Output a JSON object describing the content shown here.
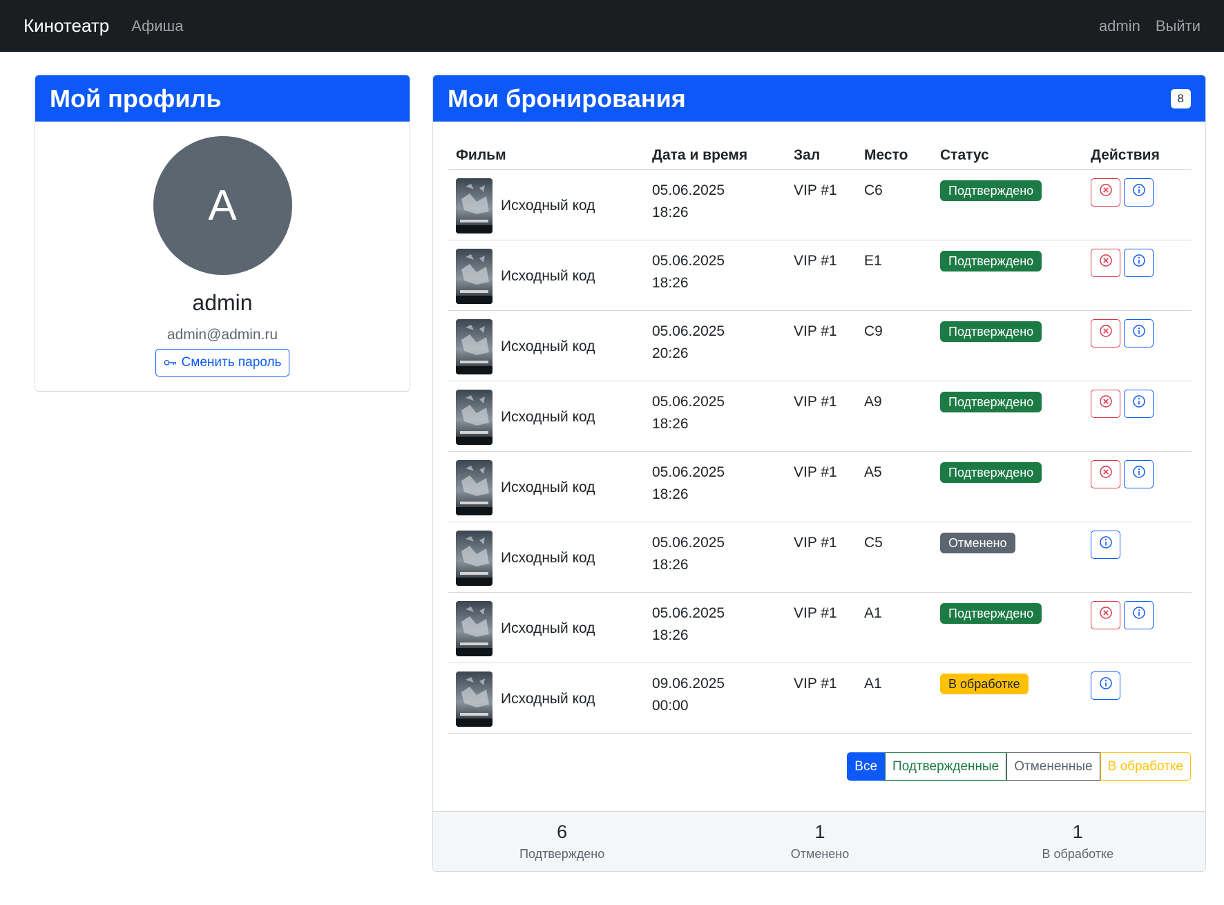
{
  "navbar": {
    "brand": "Кинотеатр",
    "afisha": "Афиша",
    "user": "admin",
    "logout": "Выйти"
  },
  "profile": {
    "title": "Мой профиль",
    "avatar_letter": "A",
    "name": "admin",
    "email": "admin@admin.ru",
    "change_password": "Сменить пароль",
    "change_password_icon": "key-icon"
  },
  "bookings": {
    "title": "Мои бронирования",
    "count": "8",
    "headers": {
      "film": "Фильм",
      "datetime": "Дата и время",
      "hall": "Зал",
      "seat": "Место",
      "status": "Статус",
      "actions": "Действия"
    },
    "rows": [
      {
        "film": "Исходный код",
        "date": "05.06.2025",
        "time": "18:26",
        "hall": "VIP #1",
        "seat": "C6",
        "status": "Подтверждено",
        "status_color": "#1c7a44",
        "cancel": true
      },
      {
        "film": "Исходный код",
        "date": "05.06.2025",
        "time": "18:26",
        "hall": "VIP #1",
        "seat": "E1",
        "status": "Подтверждено",
        "status_color": "#1c7a44",
        "cancel": true
      },
      {
        "film": "Исходный код",
        "date": "05.06.2025",
        "time": "20:26",
        "hall": "VIP #1",
        "seat": "C9",
        "status": "Подтверждено",
        "status_color": "#1c7a44",
        "cancel": true
      },
      {
        "film": "Исходный код",
        "date": "05.06.2025",
        "time": "18:26",
        "hall": "VIP #1",
        "seat": "A9",
        "status": "Подтверждено",
        "status_color": "#1c7a44",
        "cancel": true
      },
      {
        "film": "Исходный код",
        "date": "05.06.2025",
        "time": "18:26",
        "hall": "VIP #1",
        "seat": "A5",
        "status": "Подтверждено",
        "status_color": "#1c7a44",
        "cancel": true
      },
      {
        "film": "Исходный код",
        "date": "05.06.2025",
        "time": "18:26",
        "hall": "VIP #1",
        "seat": "C5",
        "status": "Отменено",
        "status_color": "#5c6670",
        "cancel": false
      },
      {
        "film": "Исходный код",
        "date": "05.06.2025",
        "time": "18:26",
        "hall": "VIP #1",
        "seat": "A1",
        "status": "Подтверждено",
        "status_color": "#1c7a44",
        "cancel": true
      },
      {
        "film": "Исходный код",
        "date": "09.06.2025",
        "time": "00:00",
        "hall": "VIP #1",
        "seat": "A1",
        "status": "В обработке",
        "status_color": "#ffc107",
        "cancel": false
      }
    ],
    "filters": [
      {
        "label": "Все",
        "active": true,
        "color": "#0d59f7"
      },
      {
        "label": "Подтвержденные",
        "active": false,
        "color": "#1c7a44"
      },
      {
        "label": "Отмененные",
        "active": false,
        "color": "#5c6670"
      },
      {
        "label": "В обработке",
        "active": false,
        "color": "#ffc107"
      }
    ],
    "stats": [
      {
        "value": "6",
        "label": "Подтверждено"
      },
      {
        "value": "1",
        "label": "Отменено"
      },
      {
        "value": "1",
        "label": "В обработке"
      }
    ]
  }
}
